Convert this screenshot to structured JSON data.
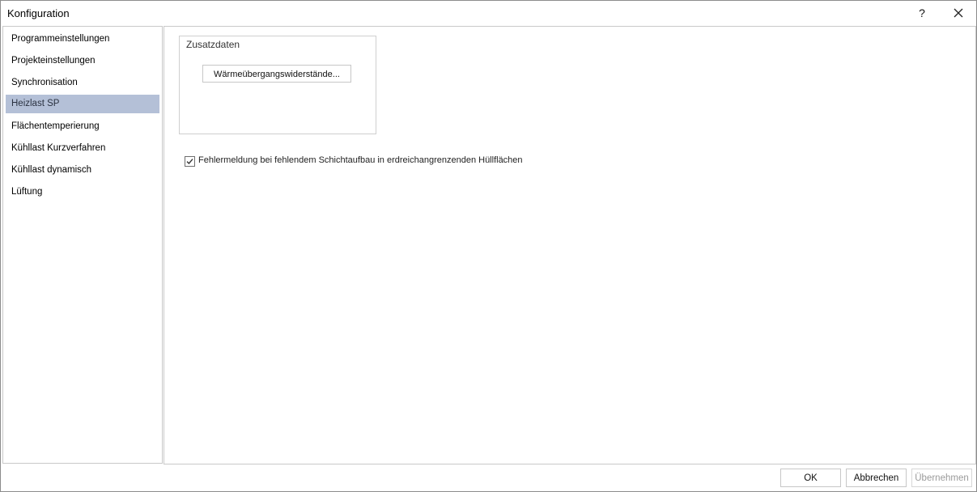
{
  "window": {
    "title": "Konfiguration",
    "help_label": "?",
    "close_icon": "close-icon"
  },
  "sidebar": {
    "items": [
      {
        "label": "Programmeinstellungen",
        "selected": false
      },
      {
        "label": "Projekteinstellungen",
        "selected": false
      },
      {
        "label": "Synchronisation",
        "selected": false
      },
      {
        "label": "Heizlast SP",
        "selected": true
      },
      {
        "label": "Flächentemperierung",
        "selected": false
      },
      {
        "label": "Kühllast Kurzverfahren",
        "selected": false
      },
      {
        "label": "Kühllast dynamisch",
        "selected": false
      },
      {
        "label": "Lüftung",
        "selected": false
      }
    ]
  },
  "content": {
    "group_title": "Zusatzdaten",
    "waerme_button": "Wärmeübergangswiderstände...",
    "checkbox": {
      "label": "Fehlermeldung bei fehlendem Schichtaufbau in erdreichangrenzenden Hüllflächen",
      "checked": true
    }
  },
  "footer": {
    "ok": "OK",
    "cancel": "Abbrechen",
    "apply": "Übernehmen"
  },
  "colors": {
    "selection": "#b4c0d7",
    "border": "#c9c9c9"
  }
}
